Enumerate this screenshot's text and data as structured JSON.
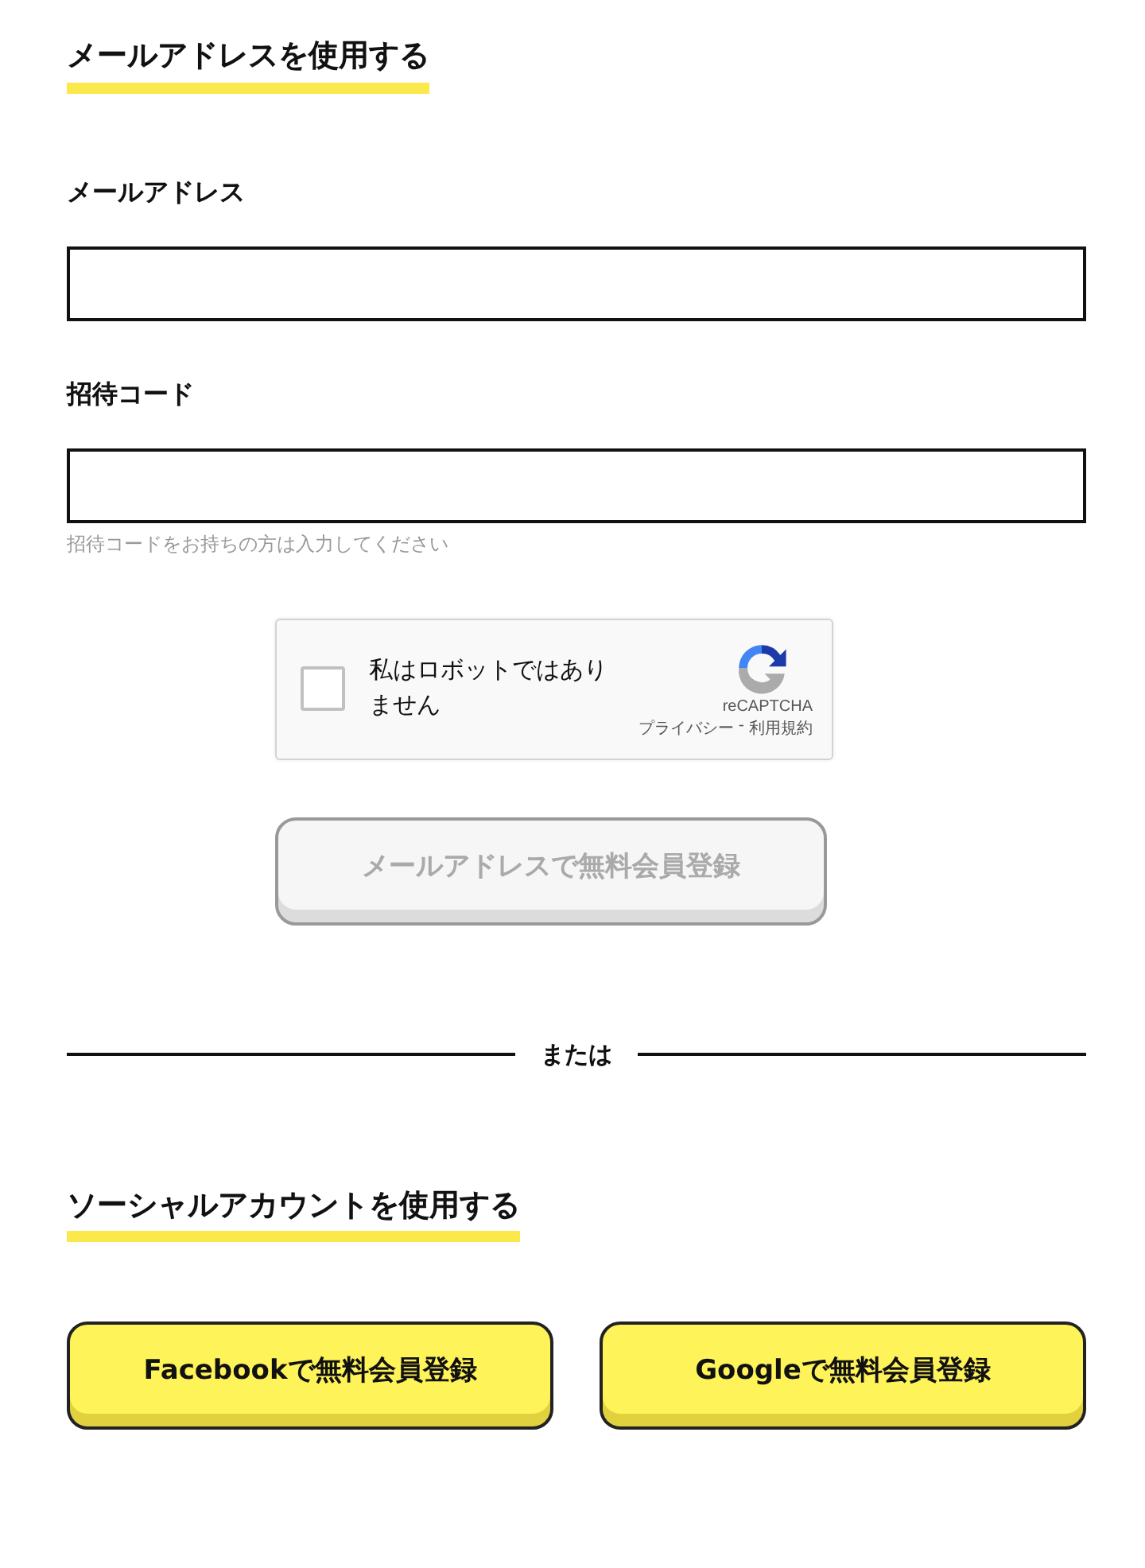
{
  "email_section": {
    "heading": "メールアドレスを使用する"
  },
  "fields": [
    {
      "label": "メールアドレス"
    },
    {
      "label": "招待コード",
      "hint": "招待コードをお持ちの方は入力してください"
    }
  ],
  "captcha": {
    "label": "私はロボットではありません",
    "checked": false,
    "brand": "reCAPTCHA",
    "links": [
      "プライバシー",
      "利用規約"
    ],
    "separator": "-"
  },
  "submit": {
    "label": "メールアドレスで無料会員登録",
    "disabled": true
  },
  "divider": {
    "label": "または"
  },
  "social_section": {
    "heading": "ソーシャルアカウントを使用する"
  },
  "social_buttons": [
    {
      "label": "Facebookで無料会員登録"
    },
    {
      "label": "Googleで無料会員登録"
    }
  ]
}
